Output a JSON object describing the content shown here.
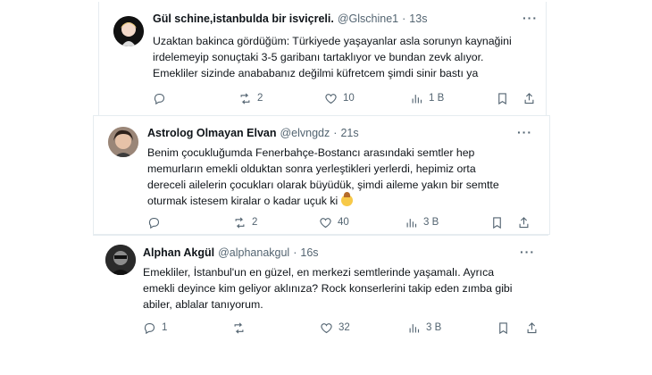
{
  "tweets": [
    {
      "name": "Gül schine,istanbulda bir isviçreli.",
      "handle": "@Glschine1",
      "time": "13s",
      "lines": [
        "Uzaktan bakinca gördüğüm: Türkiyede yaşayanlar asla sorunyn kaynağini",
        "irdelemeyip sonuçtaki 3-5 garibanı tartaklıyor ve bundan zevk alıyor.",
        "Emekliler sizinde anababanız değilmi küfretcem şimdi sinir bastı ya"
      ],
      "replies": "",
      "retweets": "2",
      "likes": "10",
      "views": "1 B"
    },
    {
      "name": "Astrolog Olmayan Elvan",
      "handle": "@elvngdz",
      "time": "21s",
      "lines": [
        "Benim çocukluğumda Fenerbahçe-Bostancı arasındaki semtler hep",
        "memurların emekli olduktan sonra yerleştikleri yerlerdi, hepimiz orta",
        "dereceli ailelerin çocukları olarak büyüdük, şimdi aileme yakın bir semtte",
        "oturmak istesem kiralar o kadar uçuk ki"
      ],
      "replies": "",
      "retweets": "2",
      "likes": "40",
      "views": "3 B"
    },
    {
      "name": "Alphan Akgül",
      "handle": "@alphanakgul",
      "time": "16s",
      "lines": [
        "Emekliler, İstanbul'un en güzel, en merkezi semtlerinde yaşamalı. Ayrıca",
        "emekli deyince kim geliyor aklınıza? Rock konserlerini takip eden zımba gibi",
        "abiler, ablalar tanıyorum."
      ],
      "replies": "1",
      "retweets": "",
      "likes": "32",
      "views": "3 B"
    }
  ],
  "icons": {
    "reply": "reply-icon",
    "retweet": "retweet-icon",
    "like": "heart-icon",
    "views": "views-icon",
    "bookmark": "bookmark-icon",
    "share": "share-icon",
    "more": "more-icon"
  },
  "colors": {
    "text": "#0f1419",
    "muted": "#536471",
    "border": "#e6ecf0"
  }
}
